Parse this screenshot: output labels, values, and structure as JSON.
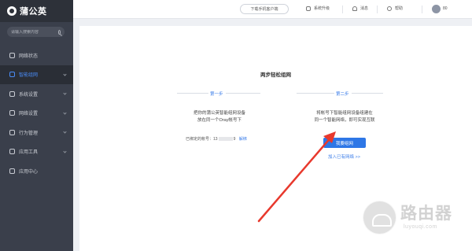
{
  "app": {
    "logo_text": "蒲公英"
  },
  "sidebar": {
    "search_placeholder": "请输入搜索内容",
    "items": [
      {
        "label": "网络状态",
        "icon": "network-status-icon",
        "active": false,
        "has_submenu": false
      },
      {
        "label": "智能组网",
        "icon": "smart-network-icon",
        "active": true,
        "has_submenu": true
      },
      {
        "label": "系统设置",
        "icon": "gear-icon",
        "active": false,
        "has_submenu": true
      },
      {
        "label": "网络设置",
        "icon": "globe-icon",
        "active": false,
        "has_submenu": true
      },
      {
        "label": "行为管理",
        "icon": "shield-icon",
        "active": false,
        "has_submenu": true
      },
      {
        "label": "应用工具",
        "icon": "toolbox-icon",
        "active": false,
        "has_submenu": true
      },
      {
        "label": "应用中心",
        "icon": "apps-icon",
        "active": false,
        "has_submenu": false
      }
    ]
  },
  "topbar": {
    "download_app": "下载手机客户端",
    "system_upgrade": "系统升级",
    "messages": "消息",
    "help": "帮助",
    "username": "80"
  },
  "main": {
    "title": "两步轻松组网",
    "step1": {
      "label": "第一步",
      "desc_line1": "把你的蒲公英智能组网设备",
      "desc_line2": "放在同一个Oray帐号下",
      "bound_label": "已绑定的帐号：",
      "bound_value_prefix": "13",
      "bound_value_suffix": "9",
      "unbind": "解绑"
    },
    "step2": {
      "label": "第二步",
      "desc_line1": "将帐号下智能组网设备组建在",
      "desc_line2": "同一个智能网络，即可实现互联",
      "primary_button": "我要组网",
      "join_link": "加入已有网络 >>"
    }
  },
  "watermark": {
    "cn": "路由器",
    "en": "luyouqi.com"
  },
  "colors": {
    "accent": "#2e77e6",
    "sidebar_bg": "#3a3f4b",
    "arrow": "#e8392d"
  }
}
